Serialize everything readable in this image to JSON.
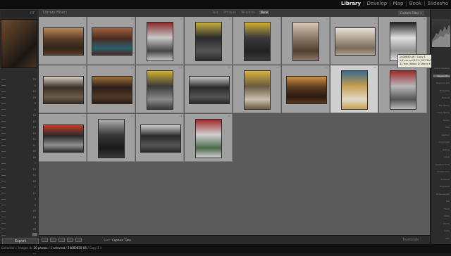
{
  "modules": [
    "Library",
    "Develop",
    "Map",
    "Book",
    "Slidesho"
  ],
  "active_module": "Library",
  "grid_title": "Library Filter :",
  "filters": [
    {
      "label": "Text",
      "active": false
    },
    {
      "label": "Attribute",
      "active": false
    },
    {
      "label": "Metadata",
      "active": false
    },
    {
      "label": "None",
      "active": true
    }
  ],
  "custom_filter": "Custom Filter ÷",
  "navigator_zoom": "FIT",
  "left_counts": [
    "74",
    "0",
    "10",
    "74",
    "9",
    "1",
    "14",
    "12",
    "19",
    "10",
    "11",
    "41",
    "93",
    "16",
    "7",
    "13",
    "11",
    "18",
    "1",
    "11",
    "3",
    "0",
    "22",
    "14",
    "4",
    "26",
    "8",
    "12",
    "1",
    "10"
  ],
  "export_label": "Export",
  "tooltip_lines": [
    "2008850-06 · Copy 1",
    "1/4 sec at f/11.0, ISO 100",
    "32 mm (Nikon D 50mm f/1.8 G)"
  ],
  "sort_label": "Sort:",
  "sort_value": "Capture Time",
  "thumbnails_label": "Thumbnails",
  "status": {
    "prefix": "Collection : Images dc",
    "count": "20 photos / 1 selected / 20080850-06",
    "suffix": "/ Copy 1 ▾"
  },
  "right_rows": [
    {
      "label": "Quick Develop",
      "highlight": false
    },
    {
      "label": "Keywording",
      "highlight": true
    },
    {
      "label": "Keyword List",
      "highlight": false
    },
    {
      "label": "Metadata",
      "highlight": false
    },
    {
      "label": "Default",
      "highlight": false
    },
    {
      "label": "File Name",
      "highlight": false
    },
    {
      "label": "Copy Name",
      "highlight": false
    },
    {
      "label": "Folder",
      "highlight": false
    },
    {
      "label": "Title",
      "highlight": false
    },
    {
      "label": "Caption",
      "highlight": false
    },
    {
      "label": "Copyright",
      "highlight": false
    },
    {
      "label": "Rating",
      "highlight": false
    },
    {
      "label": "Label",
      "highlight": false
    },
    {
      "label": "Capture Time",
      "highlight": false
    },
    {
      "label": "Dimensions",
      "highlight": false
    },
    {
      "label": "Cropped",
      "highlight": false
    },
    {
      "label": "Exposure",
      "highlight": false
    },
    {
      "label": "Focal Length",
      "highlight": false
    },
    {
      "label": "ISO",
      "highlight": false
    },
    {
      "label": "Flash",
      "highlight": false
    },
    {
      "label": "Make",
      "highlight": false
    },
    {
      "label": "Model",
      "highlight": false
    },
    {
      "label": "Lens",
      "highlight": false
    },
    {
      "label": "GPS",
      "highlight": false
    }
  ],
  "photos": [
    {
      "index": "1",
      "orient": "land",
      "colors": [
        "#5a3e28",
        "#b88a5a",
        "#2e2418"
      ]
    },
    {
      "index": "2",
      "orient": "land",
      "colors": [
        "#4a2a20",
        "#a06040",
        "#2a6070"
      ]
    },
    {
      "index": "3",
      "orient": "port",
      "colors": [
        "#c8c8c8",
        "#8a2a2a",
        "#444444"
      ]
    },
    {
      "index": "4",
      "orient": "port",
      "colors": [
        "#2a2a2a",
        "#c8b040",
        "#555555"
      ]
    },
    {
      "index": "5",
      "orient": "port",
      "colors": [
        "#3a3a3a",
        "#d0b030",
        "#222222"
      ]
    },
    {
      "index": "6",
      "orient": "port",
      "colors": [
        "#8a7a6a",
        "#d8c8b8",
        "#504030"
      ]
    },
    {
      "index": "7",
      "orient": "land",
      "colors": [
        "#b0a090",
        "#e8e0d8",
        "#7a6a5a"
      ]
    },
    {
      "index": "8",
      "orient": "port",
      "colors": [
        "#e0e0e0",
        "#202020",
        "#909090"
      ]
    },
    {
      "index": "9",
      "orient": "land",
      "colors": [
        "#3a3028",
        "#d8d0c0",
        "#6a5a48"
      ]
    },
    {
      "index": "10",
      "orient": "land",
      "colors": [
        "#2a1e18",
        "#a0703a",
        "#503828"
      ]
    },
    {
      "index": "11",
      "orient": "port",
      "colors": [
        "#3a3a3a",
        "#d0b030",
        "#8a8a8a"
      ]
    },
    {
      "index": "12",
      "orient": "land",
      "colors": [
        "#2a2a2a",
        "#c8c8c8",
        "#555555"
      ]
    },
    {
      "index": "13",
      "orient": "port",
      "colors": [
        "#6a5a40",
        "#d8b040",
        "#c8c0b0"
      ]
    },
    {
      "index": "14",
      "orient": "land",
      "colors": [
        "#5a3a20",
        "#d09040",
        "#2a1a10"
      ]
    },
    {
      "index": "15",
      "orient": "port",
      "colors": [
        "#c8a050",
        "#3a6a8a",
        "#e0d8c8"
      ]
    },
    {
      "index": "16",
      "orient": "port",
      "colors": [
        "#b8b8b8",
        "#a02a2a",
        "#555555"
      ]
    },
    {
      "index": "17",
      "orient": "land",
      "colors": [
        "#2a2a2a",
        "#c83a2a",
        "#909090"
      ]
    },
    {
      "index": "18",
      "orient": "port",
      "colors": [
        "#3a3a3a",
        "#b0b0b0",
        "#1a1a1a"
      ]
    },
    {
      "index": "19",
      "orient": "land",
      "colors": [
        "#2a2a2a",
        "#d0d0d0",
        "#555555"
      ]
    },
    {
      "index": "20",
      "orient": "port",
      "colors": [
        "#d0d0d0",
        "#a02a2a",
        "#4a6a4a"
      ]
    }
  ],
  "selected_index": 14
}
